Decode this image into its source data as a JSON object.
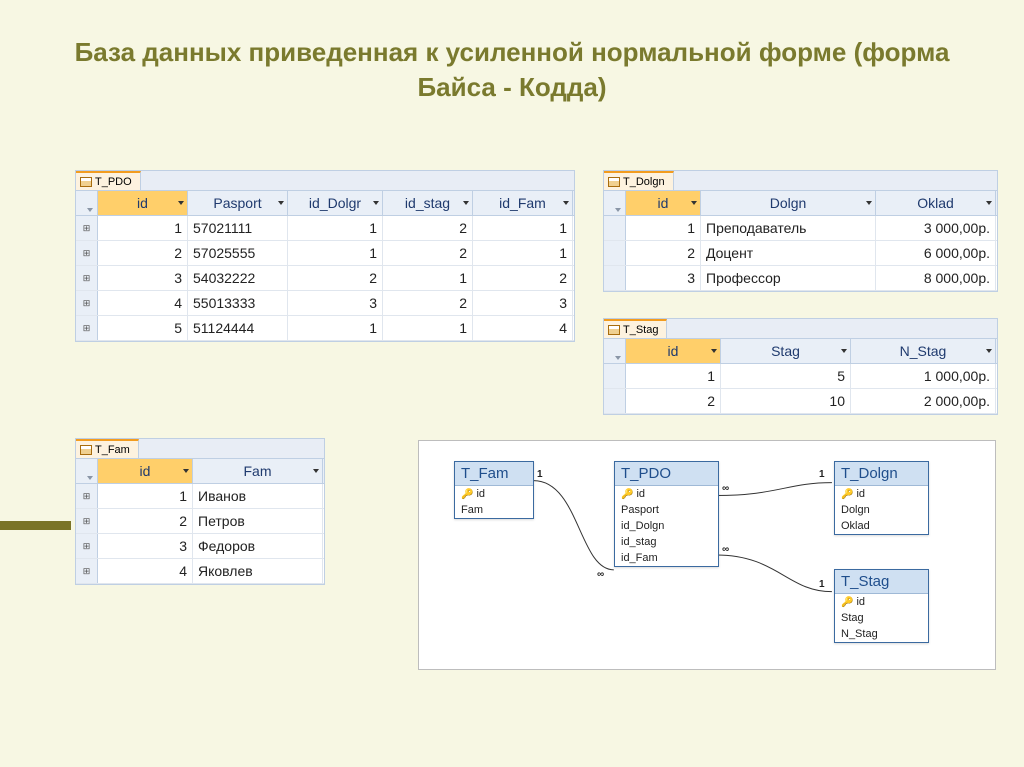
{
  "title": "База данных приведенная к усиленной нормальной форме  (форма Байса - Кодда)",
  "tables": {
    "pdo": {
      "tab": "T_PDO",
      "headers": [
        "id",
        "Pasport",
        "id_Dolgr",
        "id_stag",
        "id_Fam"
      ],
      "rows": [
        [
          "1",
          "57021111",
          "1",
          "2",
          "1"
        ],
        [
          "2",
          "57025555",
          "1",
          "2",
          "1"
        ],
        [
          "3",
          "54032222",
          "2",
          "1",
          "2"
        ],
        [
          "4",
          "55013333",
          "3",
          "2",
          "3"
        ],
        [
          "5",
          "51124444",
          "1",
          "1",
          "4"
        ]
      ]
    },
    "dolgn": {
      "tab": "T_Dolgn",
      "headers": [
        "id",
        "Dolgn",
        "Oklad"
      ],
      "rows": [
        [
          "1",
          "Преподаватель",
          "3 000,00р."
        ],
        [
          "2",
          "Доцент",
          "6 000,00р."
        ],
        [
          "3",
          "Профессор",
          "8 000,00р."
        ]
      ]
    },
    "stag": {
      "tab": "T_Stag",
      "headers": [
        "id",
        "Stag",
        "N_Stag"
      ],
      "rows": [
        [
          "1",
          "5",
          "1 000,00р."
        ],
        [
          "2",
          "10",
          "2 000,00р."
        ]
      ]
    },
    "fam": {
      "tab": "T_Fam",
      "headers": [
        "id",
        "Fam"
      ],
      "rows": [
        [
          "1",
          "Иванов"
        ],
        [
          "2",
          "Петров"
        ],
        [
          "3",
          "Федоров"
        ],
        [
          "4",
          "Яковлев"
        ]
      ]
    }
  },
  "diagram": {
    "entities": {
      "fam": {
        "title": "T_Fam",
        "fields": [
          "id",
          "Fam"
        ]
      },
      "pdo": {
        "title": "T_PDO",
        "fields": [
          "id",
          "Pasport",
          "id_Dolgn",
          "id_stag",
          "id_Fam"
        ]
      },
      "dolgn": {
        "title": "T_Dolgn",
        "fields": [
          "id",
          "Dolgn",
          "Oklad"
        ]
      },
      "stag": {
        "title": "T_Stag",
        "fields": [
          "id",
          "Stag",
          "N_Stag"
        ]
      }
    },
    "rel": {
      "one": "1",
      "many": "∞"
    }
  }
}
